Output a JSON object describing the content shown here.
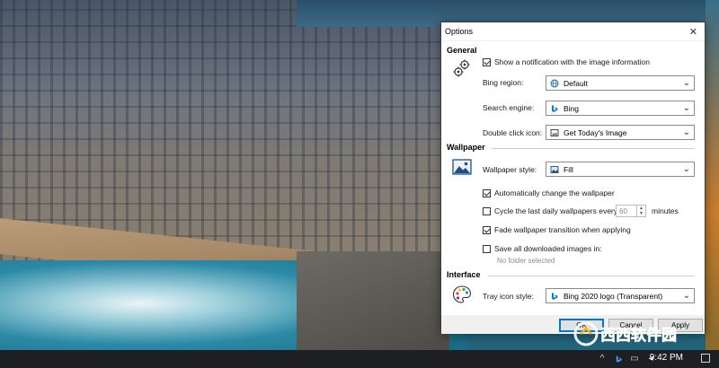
{
  "dialog": {
    "title": "Options",
    "general": {
      "heading": "General",
      "show_notification": {
        "label": "Show a notification with the image information",
        "checked": true
      },
      "bing_region": {
        "label": "Bing region:",
        "value": "Default"
      },
      "search_engine": {
        "label": "Search engine:",
        "value": "Bing"
      },
      "double_click": {
        "label": "Double click icon:",
        "value": "Get Today's Image"
      }
    },
    "wallpaper": {
      "heading": "Wallpaper",
      "style": {
        "label": "Wallpaper style:",
        "value": "Fill"
      },
      "auto_change": {
        "label": "Automatically change the wallpaper",
        "checked": true
      },
      "cycle": {
        "label": "Cycle the last daily wallpapers every:",
        "checked": false,
        "value": "60",
        "unit": "minutes"
      },
      "fade": {
        "label": "Fade wallpaper transition when applying",
        "checked": true
      },
      "save_all": {
        "label": "Save all downloaded images in:",
        "checked": false
      },
      "folder_status": "No folder selected"
    },
    "interface": {
      "heading": "Interface",
      "tray_style": {
        "label": "Tray icon style:",
        "value": "Bing 2020 logo (Transparent)"
      }
    },
    "buttons": {
      "ok": "OK",
      "cancel": "Cancel",
      "apply": "Apply"
    }
  },
  "taskbar": {
    "time": "9:42 PM"
  },
  "watermark": {
    "text": "西西软件园"
  },
  "colors": {
    "accent": "#0078d7",
    "bing_blue": "#0a7cd8",
    "taskbar": "#1e1f22"
  }
}
